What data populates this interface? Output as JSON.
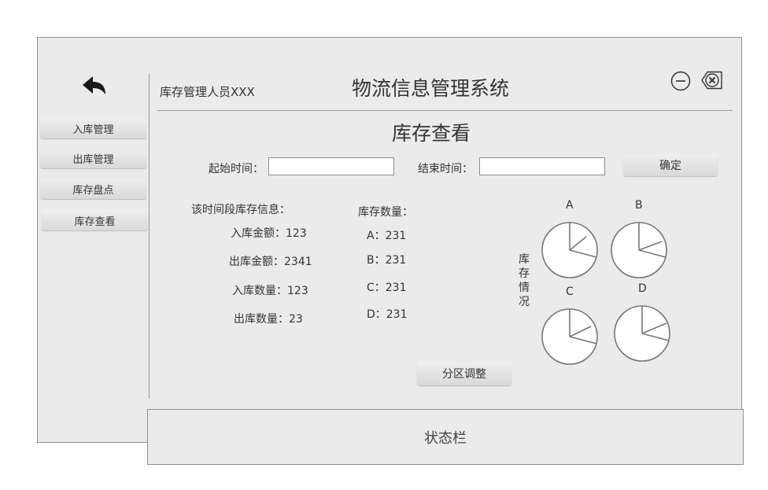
{
  "app": {
    "title": "物流信息管理系统",
    "user": "库存管理人员XXX",
    "status_bar": "状态栏"
  },
  "sidebar": {
    "items": [
      {
        "label": "入库管理"
      },
      {
        "label": "出库管理"
      },
      {
        "label": "库存盘点"
      },
      {
        "label": "库存查看"
      }
    ]
  },
  "page": {
    "title": "库存查看",
    "start_label": "起始时间：",
    "start_value": "",
    "end_label": "结束时间：",
    "end_value": "",
    "confirm_label": "确定",
    "info_title": "该时间段库存信息：",
    "info": [
      {
        "label": "入库金额：123"
      },
      {
        "label": "出库金额：2341"
      },
      {
        "label": "入库数量：123"
      },
      {
        "label": "出库数量：23"
      }
    ],
    "qty_title": "库存数量：",
    "qty": [
      {
        "label": "A：231"
      },
      {
        "label": "B：231"
      },
      {
        "label": "C：231"
      },
      {
        "label": "D：231"
      }
    ],
    "adjust_label": "分区调整",
    "stock_status_label": "库存情况",
    "pies": [
      {
        "label": "A"
      },
      {
        "label": "B"
      },
      {
        "label": "C"
      },
      {
        "label": "D"
      }
    ]
  },
  "icons": {
    "back": "back-arrow-icon",
    "minimize": "minimize-circle-icon",
    "close": "close-tag-icon"
  }
}
